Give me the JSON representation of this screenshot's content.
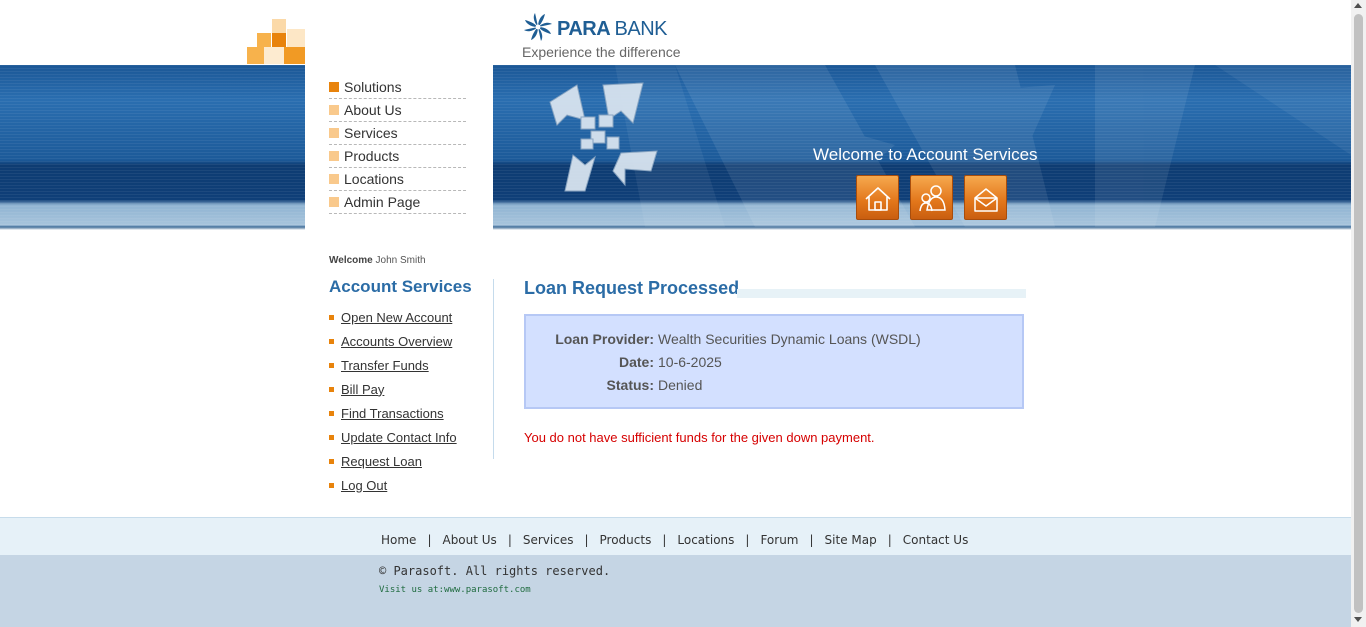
{
  "brand": {
    "name_bold": "PARA",
    "name_light": "BANK",
    "tagline": "Experience the difference",
    "colors": {
      "primary": "#1f5e94",
      "accent": "#e8830c"
    }
  },
  "top_menu": {
    "items": [
      {
        "label": "Solutions",
        "active": true
      },
      {
        "label": "About Us",
        "active": false
      },
      {
        "label": "Services",
        "active": false
      },
      {
        "label": "Products",
        "active": false
      },
      {
        "label": "Locations",
        "active": false
      },
      {
        "label": "Admin Page",
        "active": false
      }
    ]
  },
  "header": {
    "welcome_banner": "Welcome to Account Services",
    "icons": [
      {
        "icon": "home-icon"
      },
      {
        "icon": "about-icon"
      },
      {
        "icon": "contact-icon"
      }
    ]
  },
  "sidebar": {
    "welcome_label": "Welcome",
    "user_name": "John Smith",
    "title": "Account Services",
    "links": [
      {
        "label": "Open New Account"
      },
      {
        "label": "Accounts Overview"
      },
      {
        "label": "Transfer Funds"
      },
      {
        "label": "Bill Pay"
      },
      {
        "label": "Find Transactions"
      },
      {
        "label": "Update Contact Info"
      },
      {
        "label": "Request Loan"
      },
      {
        "label": "Log Out"
      }
    ]
  },
  "main": {
    "title": "Loan Request Processed",
    "result": {
      "rows": [
        {
          "label": "Loan Provider:",
          "value": "Wealth Securities Dynamic Loans (WSDL)"
        },
        {
          "label": "Date:",
          "value": "10-6-2025"
        },
        {
          "label": "Status:",
          "value": "Denied"
        }
      ]
    },
    "error_message": "You do not have sufficient funds for the given down payment.",
    "error_color": "#d60000"
  },
  "footer": {
    "links": [
      {
        "label": "Home"
      },
      {
        "label": "About Us"
      },
      {
        "label": "Services"
      },
      {
        "label": "Products"
      },
      {
        "label": "Locations"
      },
      {
        "label": "Forum"
      },
      {
        "label": "Site Map"
      },
      {
        "label": "Contact Us"
      }
    ],
    "separator": "|",
    "copyright": "© Parasoft. All rights reserved.",
    "visit_prefix": "Visit us at:",
    "visit_url": "www.parasoft.com"
  }
}
